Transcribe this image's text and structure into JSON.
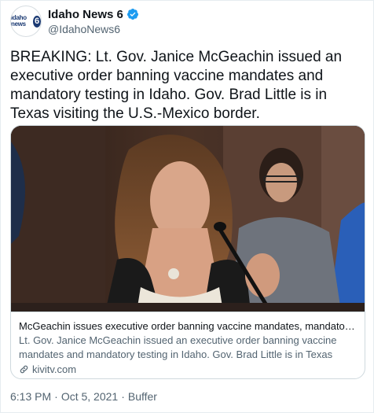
{
  "account": {
    "display_name": "Idaho News 6",
    "handle": "@IdahoNews6",
    "avatar_logo_text": "idaho news",
    "avatar_logo_number": "6",
    "verified_icon": "verified-badge-icon",
    "verified_color": "#1d9bf0"
  },
  "tweet": {
    "text": "BREAKING: Lt. Gov. Janice McGeachin issued an executive order banning vaccine mandates and mandatory testing in Idaho. Gov. Brad Little is in Texas visiting the U.S.-Mexico border."
  },
  "card": {
    "title": "McGeachin issues executive order banning vaccine mandates, mandatory testi…",
    "description": "Lt. Gov. Janice McGeachin issued an executive order banning vaccine mandates and mandatory testing in Idaho. Gov. Brad Little is in Texas visiting the U.S.-…",
    "domain": "kivitv.com",
    "domain_icon": "link-icon"
  },
  "footer": {
    "time": "6:13 PM",
    "separator1": "·",
    "date": "Oct 5, 2021",
    "separator2": "·",
    "source": "Buffer"
  }
}
